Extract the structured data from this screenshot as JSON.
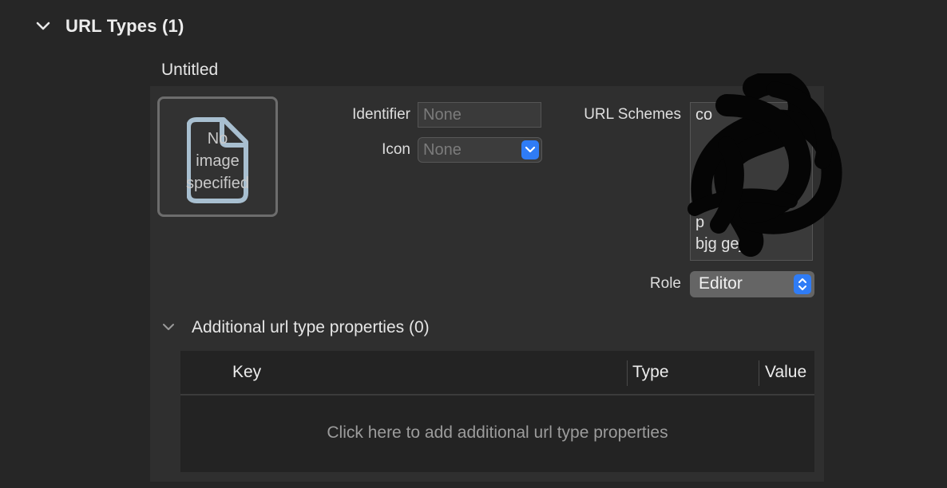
{
  "section": {
    "title": "URL Types (1)"
  },
  "entry": {
    "title": "Untitled",
    "image_well": {
      "placeholder": "No\nimage\nspecified"
    },
    "identifier": {
      "label": "Identifier",
      "placeholder": "None"
    },
    "icon": {
      "label": "Icon",
      "value": "None"
    },
    "url_schemes": {
      "label": "URL Schemes",
      "lines": [
        "co",
        "",
        "",
        "",
        "",
        "p",
        "bjg gej9c"
      ]
    },
    "role": {
      "label": "Role",
      "value": "Editor"
    }
  },
  "additional": {
    "title": "Additional url type properties (0)",
    "columns": [
      "Key",
      "Type",
      "Value"
    ],
    "empty_text": "Click here to add additional url type properties"
  },
  "colors": {
    "accent": "#2f7cf6",
    "panel": "#2f2f2f",
    "background": "#262626"
  }
}
